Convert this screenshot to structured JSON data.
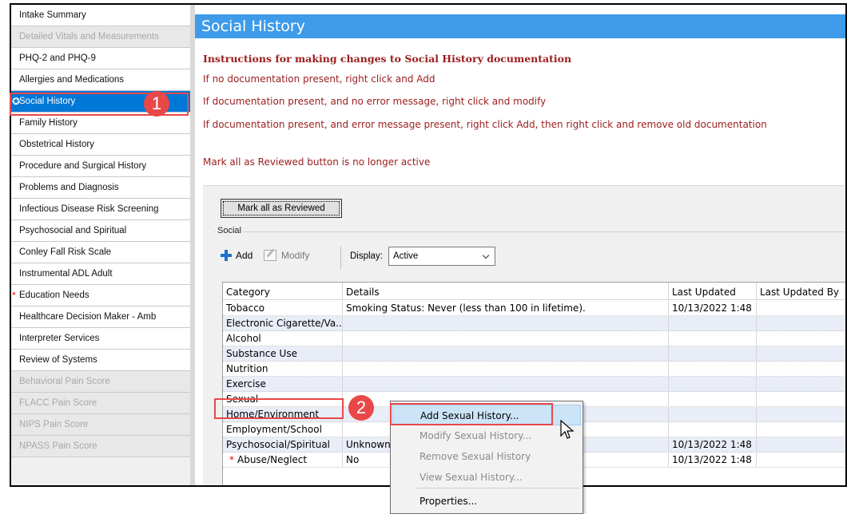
{
  "sidebar": {
    "items": [
      {
        "label": "Intake Summary",
        "state": "normal"
      },
      {
        "label": "Detailed Vitals and Measurements",
        "state": "disabled"
      },
      {
        "label": "PHQ-2 and PHQ-9",
        "state": "normal"
      },
      {
        "label": "Allergies and Medications",
        "state": "normal"
      },
      {
        "label": "Social History",
        "state": "selected",
        "marker": "✪"
      },
      {
        "label": "Family History",
        "state": "normal"
      },
      {
        "label": "Obstetrical History",
        "state": "normal"
      },
      {
        "label": "Procedure and Surgical History",
        "state": "normal"
      },
      {
        "label": "Problems and Diagnosis",
        "state": "normal"
      },
      {
        "label": "Infectious Disease Risk Screening",
        "state": "normal"
      },
      {
        "label": "Psychosocial and Spiritual",
        "state": "normal"
      },
      {
        "label": "Conley Fall Risk Scale",
        "state": "normal"
      },
      {
        "label": "Instrumental ADL Adult",
        "state": "normal"
      },
      {
        "label": "Education Needs",
        "state": "normal",
        "marker": "*"
      },
      {
        "label": "Healthcare Decision Maker - Amb",
        "state": "normal"
      },
      {
        "label": "Interpreter Services",
        "state": "normal"
      },
      {
        "label": "Review of Systems",
        "state": "normal"
      },
      {
        "label": "Behavioral Pain Score",
        "state": "disabled"
      },
      {
        "label": "FLACC Pain Score",
        "state": "disabled"
      },
      {
        "label": "NIPS Pain Score",
        "state": "disabled"
      },
      {
        "label": "NPASS Pain Score",
        "state": "disabled"
      }
    ]
  },
  "main": {
    "title": "Social History",
    "instructions": {
      "heading": "Instructions for making changes to Social History documentation",
      "lines": [
        "If no documentation present, right click and Add",
        "If documentation present, and no error message, right click and modify",
        "If documentation present, and error message present, right click Add, then right click and remove old documentation"
      ],
      "note": "Mark all as Reviewed button is no longer active"
    },
    "mark_reviewed_label": "Mark all as Reviewed",
    "group_label": "Social",
    "toolbar": {
      "add_label": "Add",
      "modify_label": "Modify",
      "display_label": "Display:",
      "display_value": "Active"
    },
    "grid": {
      "columns": [
        "Category",
        "Details",
        "Last Updated",
        "Last Updated By"
      ],
      "rows": [
        {
          "category": "Tobacco",
          "details": "Smoking Status: Never (less than 100 in lifetime).",
          "updated": "10/13/2022 1:48 ...",
          "by": ""
        },
        {
          "category": "Electronic Cigarette/Va...",
          "details": "",
          "updated": "",
          "by": ""
        },
        {
          "category": "Alcohol",
          "details": "",
          "updated": "",
          "by": ""
        },
        {
          "category": "Substance Use",
          "details": "",
          "updated": "",
          "by": ""
        },
        {
          "category": "Nutrition",
          "details": "",
          "updated": "",
          "by": ""
        },
        {
          "category": "Exercise",
          "details": "",
          "updated": "",
          "by": ""
        },
        {
          "category": "Sexual",
          "details": "",
          "updated": "",
          "by": ""
        },
        {
          "category": "Home/Environment",
          "details": "",
          "updated": "",
          "by": ""
        },
        {
          "category": "Employment/School",
          "details": "",
          "updated": "",
          "by": ""
        },
        {
          "category": "Psychosocial/Spiritual",
          "details": "Unknown",
          "updated": "10/13/2022 1:48 ...",
          "by": ""
        },
        {
          "category": "Abuse/Neglect",
          "details": "No",
          "updated": "10/13/2022 1:48 ...",
          "by": "",
          "marker": "*"
        }
      ]
    }
  },
  "context_menu": {
    "items": [
      {
        "label": "Add Sexual History...",
        "state": "active"
      },
      {
        "label": "Modify Sexual History...",
        "state": "disabled"
      },
      {
        "label": "Remove Sexual History",
        "state": "disabled"
      },
      {
        "label": "View Sexual History...",
        "state": "disabled"
      },
      {
        "label": "Properties...",
        "state": "enabled"
      }
    ]
  },
  "callouts": {
    "step1": "1",
    "step2": "2",
    "color": "#e84848"
  },
  "colors": {
    "title_bar": "#3d9be9",
    "selected": "#0078d7",
    "instruction_text": "#9b1c1c",
    "row_alt": "#e9edf7"
  }
}
